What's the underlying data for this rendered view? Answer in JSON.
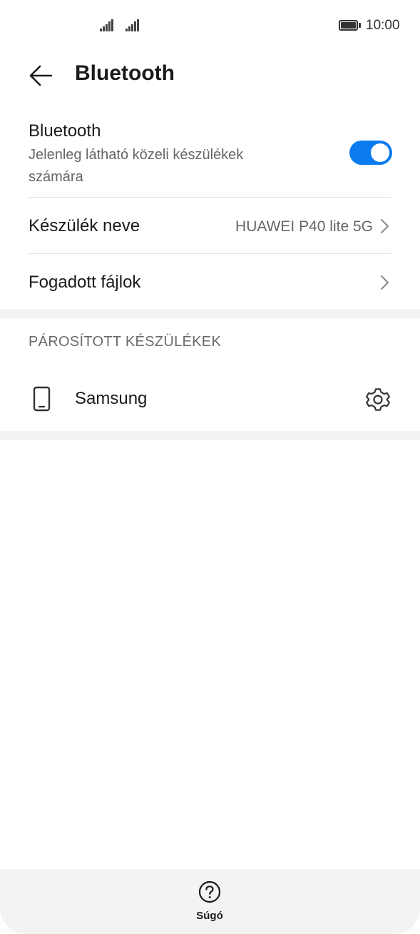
{
  "status_bar": {
    "time": "10:00",
    "signal_icons": [
      "signal-sim1-icon",
      "signal-sim2-icon"
    ],
    "battery_icon": "battery-full-icon"
  },
  "header": {
    "back_icon": "arrow-left-icon",
    "title": "Bluetooth"
  },
  "bluetooth_row": {
    "title": "Bluetooth",
    "subtitle": "Jelenleg látható közeli készülékek számára",
    "toggle_on": true,
    "accent_color": "#0a7cf0"
  },
  "device_name_row": {
    "title": "Készülék neve",
    "value": "HUAWEI P40 lite 5G",
    "chevron_icon": "chevron-right-icon"
  },
  "received_files_row": {
    "title": "Fogadott fájlok",
    "chevron_icon": "chevron-right-icon"
  },
  "paired_section": {
    "header": "PÁROSÍTOTT KÉSZÜLÉKEK",
    "devices": [
      {
        "name": "Samsung",
        "icon": "smartphone-icon",
        "settings_icon": "gear-icon"
      }
    ]
  },
  "bottom_bar": {
    "help_icon": "question-circle-icon",
    "help_label": "Súgó"
  }
}
